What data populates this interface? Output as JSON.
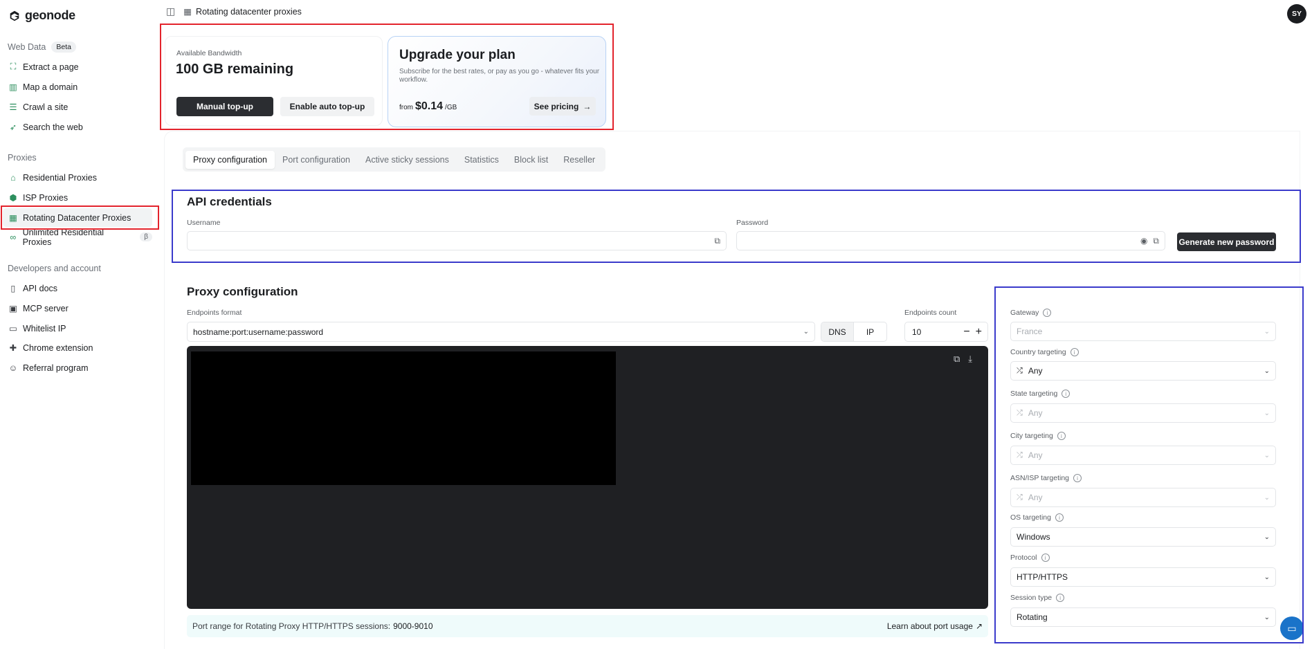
{
  "brand": {
    "name": "geonode"
  },
  "sidebar": {
    "sections": [
      {
        "title": "Web Data",
        "badge": "Beta"
      },
      {
        "title": "Proxies"
      },
      {
        "title": "Developers and account"
      }
    ],
    "web_items": [
      "Extract a page",
      "Map a domain",
      "Crawl a site",
      "Search the web"
    ],
    "proxy_items": [
      "Residential Proxies",
      "ISP Proxies",
      "Rotating Datacenter Proxies",
      "Unlimited Residential Proxies"
    ],
    "proxy_badge": "β",
    "dev_items": [
      "API docs",
      "MCP server",
      "Whitelist IP",
      "Chrome extension",
      "Referral program"
    ]
  },
  "topbar": {
    "breadcrumb": "Rotating datacenter proxies",
    "avatar": "SY"
  },
  "bandwidth": {
    "label": "Available Bandwidth",
    "value": "100 GB remaining",
    "manual_topup": "Manual top-up",
    "auto_topup": "Enable auto top-up"
  },
  "upgrade": {
    "title": "Upgrade your plan",
    "subtitle": "Subscribe for the best rates, or pay as you go - whatever fits your workflow.",
    "from": "from",
    "price": "$0.14",
    "unit": "/GB",
    "cta": "See pricing"
  },
  "tabs": [
    "Proxy configuration",
    "Port configuration",
    "Active sticky sessions",
    "Statistics",
    "Block list",
    "Reseller"
  ],
  "api": {
    "title": "API credentials",
    "username_label": "Username",
    "password_label": "Password",
    "generate": "Generate new password"
  },
  "proxy_config": {
    "title": "Proxy configuration",
    "endpoints_format_label": "Endpoints format",
    "endpoints_format_value": "hostname:port:username:password",
    "dns": "DNS",
    "ip": "IP",
    "endpoints_count_label": "Endpoints count",
    "endpoints_count_value": "10",
    "port_note": "Port range for Rotating Proxy HTTP/HTTPS sessions:",
    "port_range": "9000-9010",
    "learn": "Learn about port usage"
  },
  "targeting": {
    "gateway_label": "Gateway",
    "gateway_value": "France",
    "country_label": "Country targeting",
    "country_value": "Any",
    "state_label": "State targeting",
    "state_value": "Any",
    "city_label": "City targeting",
    "city_value": "Any",
    "asn_label": "ASN/ISP targeting",
    "asn_value": "Any",
    "os_label": "OS targeting",
    "os_value": "Windows",
    "protocol_label": "Protocol",
    "protocol_value": "HTTP/HTTPS",
    "session_label": "Session type",
    "session_value": "Rotating"
  },
  "colors": {
    "accent_green": "#2d8f5e",
    "highlight_red": "#e3232c",
    "highlight_blue": "#3a3acb",
    "dark_button": "#2b2d31"
  }
}
